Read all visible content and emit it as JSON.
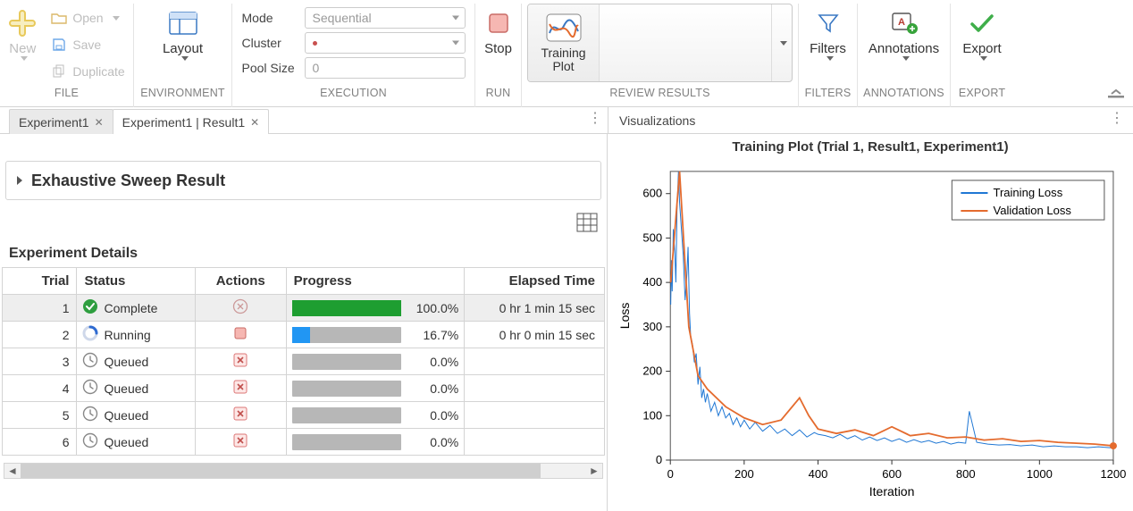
{
  "toolstrip": {
    "file": {
      "new": "New",
      "open": "Open",
      "save": "Save",
      "duplicate": "Duplicate",
      "label": "FILE"
    },
    "environment": {
      "layout": "Layout",
      "label": "ENVIRONMENT"
    },
    "execution": {
      "mode_label": "Mode",
      "mode_value": "Sequential",
      "cluster_label": "Cluster",
      "cluster_value": "",
      "pool_label": "Pool Size",
      "pool_value": "0",
      "label": "EXECUTION"
    },
    "run": {
      "stop": "Stop",
      "label": "RUN"
    },
    "review": {
      "training_plot_1": "Training",
      "training_plot_2": "Plot",
      "label": "REVIEW RESULTS"
    },
    "filters": {
      "btn": "Filters",
      "label": "FILTERS"
    },
    "annotations": {
      "btn": "Annotations",
      "label": "ANNOTATIONS"
    },
    "export": {
      "btn": "Export",
      "label": "EXPORT"
    }
  },
  "tabs": {
    "items": [
      {
        "label": "Experiment1",
        "active": false
      },
      {
        "label": "Experiment1 | Result1",
        "active": true
      }
    ],
    "visualizations_title": "Visualizations"
  },
  "accordion_title": "Exhaustive Sweep Result",
  "details": {
    "title": "Experiment Details",
    "columns": {
      "trial": "Trial",
      "status": "Status",
      "actions": "Actions",
      "progress": "Progress",
      "elapsed": "Elapsed Time"
    },
    "rows": [
      {
        "trial": 1,
        "status": "Complete",
        "status_icon": "check",
        "action_icon": "cancel-gray",
        "progress": 100.0,
        "progress_text": "100.0%",
        "progress_color": "green",
        "elapsed": "0 hr 1 min 15 sec",
        "selected": true
      },
      {
        "trial": 2,
        "status": "Running",
        "status_icon": "spin",
        "action_icon": "stop-square",
        "progress": 16.7,
        "progress_text": "16.7%",
        "progress_color": "blue",
        "elapsed": "0 hr 0 min 15 sec",
        "selected": false
      },
      {
        "trial": 3,
        "status": "Queued",
        "status_icon": "clock",
        "action_icon": "cancel-red",
        "progress": 0.0,
        "progress_text": "0.0%",
        "progress_color": "none",
        "elapsed": "",
        "selected": false
      },
      {
        "trial": 4,
        "status": "Queued",
        "status_icon": "clock",
        "action_icon": "cancel-red",
        "progress": 0.0,
        "progress_text": "0.0%",
        "progress_color": "none",
        "elapsed": "",
        "selected": false
      },
      {
        "trial": 5,
        "status": "Queued",
        "status_icon": "clock",
        "action_icon": "cancel-red",
        "progress": 0.0,
        "progress_text": "0.0%",
        "progress_color": "none",
        "elapsed": "",
        "selected": false
      },
      {
        "trial": 6,
        "status": "Queued",
        "status_icon": "clock",
        "action_icon": "cancel-red",
        "progress": 0.0,
        "progress_text": "0.0%",
        "progress_color": "none",
        "elapsed": "",
        "selected": false
      }
    ]
  },
  "chart_data": {
    "type": "line",
    "title": "Training Plot (Trial 1, Result1, Experiment1)",
    "xlabel": "Iteration",
    "ylabel": "Loss",
    "xlim": [
      0,
      1200
    ],
    "ylim": [
      0,
      650
    ],
    "xticks": [
      0,
      200,
      400,
      600,
      800,
      1000,
      1200
    ],
    "yticks": [
      0,
      100,
      200,
      300,
      400,
      500,
      600
    ],
    "legend": {
      "position": "top-right",
      "entries": [
        "Training Loss",
        "Validation Loss"
      ]
    },
    "series": [
      {
        "name": "Training Loss",
        "color": "#1f77d4",
        "x": [
          1,
          3,
          5,
          8,
          12,
          15,
          18,
          22,
          25,
          30,
          35,
          40,
          45,
          48,
          52,
          55,
          60,
          65,
          70,
          75,
          80,
          85,
          90,
          95,
          100,
          110,
          120,
          130,
          140,
          150,
          160,
          170,
          180,
          190,
          200,
          215,
          230,
          250,
          270,
          290,
          310,
          330,
          350,
          370,
          390,
          400,
          420,
          440,
          460,
          480,
          500,
          520,
          540,
          560,
          580,
          600,
          620,
          640,
          660,
          680,
          700,
          720,
          740,
          760,
          780,
          800,
          810,
          830,
          860,
          890,
          920,
          950,
          980,
          1010,
          1040,
          1070,
          1100,
          1130,
          1160,
          1190,
          1200
        ],
        "y": [
          350,
          450,
          380,
          520,
          470,
          400,
          560,
          650,
          580,
          520,
          460,
          360,
          420,
          480,
          330,
          280,
          260,
          220,
          240,
          170,
          210,
          140,
          160,
          130,
          150,
          110,
          130,
          100,
          120,
          95,
          105,
          80,
          95,
          75,
          90,
          70,
          85,
          65,
          78,
          60,
          70,
          55,
          68,
          52,
          62,
          58,
          55,
          50,
          58,
          48,
          55,
          45,
          52,
          44,
          50,
          42,
          48,
          40,
          46,
          40,
          44,
          38,
          42,
          36,
          40,
          38,
          110,
          40,
          36,
          34,
          35,
          32,
          34,
          30,
          32,
          30,
          30,
          28,
          30,
          28,
          28
        ]
      },
      {
        "name": "Validation Loss",
        "color": "#e46b2e",
        "x": [
          1,
          25,
          50,
          75,
          100,
          150,
          200,
          250,
          300,
          350,
          375,
          400,
          450,
          500,
          550,
          600,
          650,
          700,
          750,
          800,
          850,
          900,
          950,
          1000,
          1050,
          1100,
          1150,
          1200
        ],
        "y": [
          400,
          650,
          300,
          190,
          160,
          120,
          95,
          80,
          90,
          140,
          100,
          70,
          60,
          68,
          55,
          75,
          55,
          60,
          50,
          52,
          45,
          48,
          42,
          44,
          40,
          38,
          36,
          32
        ],
        "end_marker": true
      }
    ]
  }
}
